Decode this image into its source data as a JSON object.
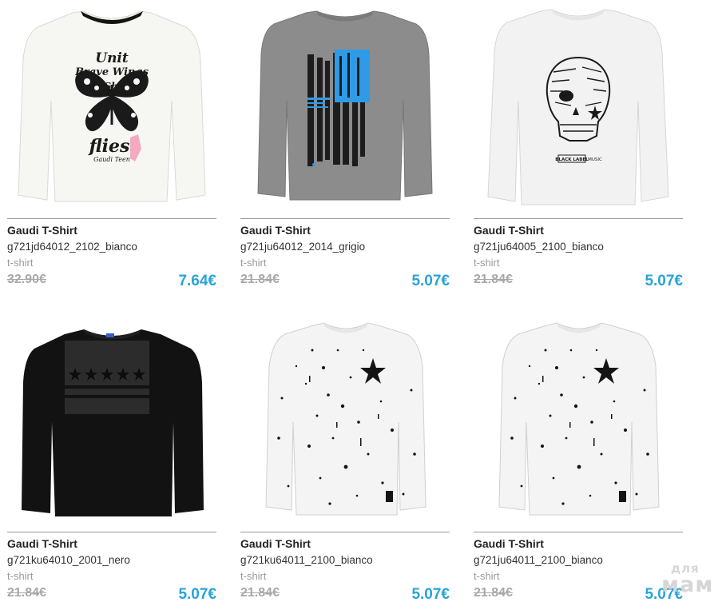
{
  "products": [
    {
      "brand": "Gaudi T-Shirt",
      "sku": "g721jd64012_2102_bianco",
      "category": "t-shirt",
      "old_price": "32.90€",
      "new_price": "7.64€",
      "print_lines": [
        "Unit",
        "Brave Wings",
        "She",
        "flies",
        "Gaudi Teen"
      ],
      "colors": {
        "shirt": "#f6f6f3",
        "collar": "#141414",
        "print": "#1a1a1a",
        "accent": "#f2a9c1"
      }
    },
    {
      "brand": "Gaudi T-Shirt",
      "sku": "g721ju64012_2014_grigio",
      "category": "t-shirt",
      "old_price": "21.84€",
      "new_price": "5.07€",
      "colors": {
        "shirt": "#8c8c8c",
        "print": "#1d1d1d",
        "accent": "#2f9ae6"
      }
    },
    {
      "brand": "Gaudi T-Shirt",
      "sku": "g721ju64005_2100_bianco",
      "category": "t-shirt",
      "old_price": "21.84€",
      "new_price": "5.07€",
      "print_lines": [
        "BLACK LABEL",
        "MUSIC"
      ],
      "colors": {
        "shirt": "#f2f2f2",
        "print": "#1a1a1a"
      }
    },
    {
      "brand": "Gaudi T-Shirt",
      "sku": "g721ku64010_2001_nero",
      "category": "t-shirt",
      "old_price": "21.84€",
      "new_price": "5.07€",
      "colors": {
        "shirt": "#121212",
        "print": "#2c2c2c",
        "accent": "#3a3a3a"
      }
    },
    {
      "brand": "Gaudi T-Shirt",
      "sku": "g721ku64011_2100_bianco",
      "category": "t-shirt",
      "old_price": "21.84€",
      "new_price": "5.07€",
      "colors": {
        "shirt": "#f4f4f4",
        "print": "#141414"
      }
    },
    {
      "brand": "Gaudi T-Shirt",
      "sku": "g721ju64011_2100_bianco",
      "category": "t-shirt",
      "old_price": "21.84€",
      "new_price": "5.07€",
      "colors": {
        "shirt": "#f4f4f4",
        "print": "#141414"
      }
    }
  ],
  "watermark": {
    "line1": "для",
    "line2": "мам"
  },
  "theme": {
    "price_color": "#29a3d9",
    "old_price_color": "#a8a8a8",
    "divider_color": "#9a9a9a"
  }
}
